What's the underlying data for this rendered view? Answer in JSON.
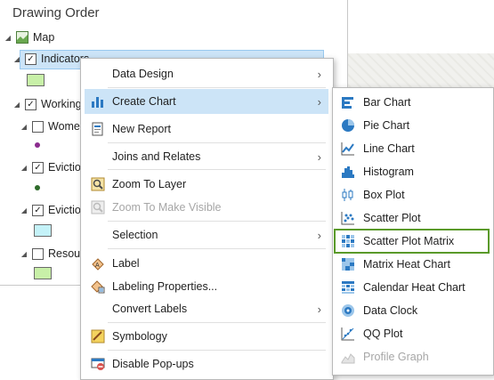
{
  "pane": {
    "title": "Drawing Order",
    "map_label": "Map",
    "layers": [
      {
        "label": "Indicators",
        "checked": true
      },
      {
        "label": "Working",
        "checked": true
      },
      {
        "label": "Wome",
        "checked": false
      },
      {
        "label": "Evictio",
        "checked": true
      },
      {
        "label": "Evictio",
        "checked": true
      },
      {
        "label": "Resour",
        "checked": false
      }
    ]
  },
  "context_menu": {
    "items": [
      {
        "label": "Data Design",
        "icon": "none",
        "submenu": true
      },
      {
        "label": "Create Chart",
        "icon": "chart-icon",
        "submenu": true,
        "highlighted": true
      },
      {
        "label": "New Report",
        "icon": "report-icon",
        "submenu": false
      },
      {
        "label": "Joins and Relates",
        "icon": "none",
        "submenu": true
      },
      {
        "label": "Zoom To Layer",
        "icon": "zoom-icon",
        "submenu": false
      },
      {
        "label": "Zoom To Make Visible",
        "icon": "zoom-visible-icon",
        "submenu": false,
        "disabled": true
      },
      {
        "label": "Selection",
        "icon": "none",
        "submenu": true
      },
      {
        "label": "Label",
        "icon": "label-icon",
        "submenu": false
      },
      {
        "label": "Labeling Properties...",
        "icon": "labeling-properties-icon",
        "submenu": false
      },
      {
        "label": "Convert Labels",
        "icon": "none",
        "submenu": true
      },
      {
        "label": "Symbology",
        "icon": "symbology-icon",
        "submenu": false
      },
      {
        "label": "Disable Pop-ups",
        "icon": "popups-icon",
        "submenu": false
      }
    ]
  },
  "chart_submenu": {
    "items": [
      {
        "label": "Bar Chart",
        "icon": "bar-chart-icon"
      },
      {
        "label": "Pie Chart",
        "icon": "pie-chart-icon"
      },
      {
        "label": "Line Chart",
        "icon": "line-chart-icon"
      },
      {
        "label": "Histogram",
        "icon": "histogram-icon"
      },
      {
        "label": "Box Plot",
        "icon": "box-plot-icon"
      },
      {
        "label": "Scatter Plot",
        "icon": "scatter-plot-icon"
      },
      {
        "label": "Scatter Plot Matrix",
        "icon": "scatter-matrix-icon",
        "focused": true
      },
      {
        "label": "Matrix Heat Chart",
        "icon": "matrix-heat-icon"
      },
      {
        "label": "Calendar Heat Chart",
        "icon": "calendar-heat-icon"
      },
      {
        "label": "Data Clock",
        "icon": "data-clock-icon"
      },
      {
        "label": "QQ Plot",
        "icon": "qq-plot-icon"
      },
      {
        "label": "Profile Graph",
        "icon": "profile-graph-icon",
        "disabled": true
      }
    ]
  },
  "colors": {
    "highlight": "#cce4f7",
    "focus_border": "#5a9a2a",
    "icon_blue": "#2b79c2",
    "symbol_green": "#c8f0a8",
    "symbol_cyan": "#c4f2f8"
  }
}
